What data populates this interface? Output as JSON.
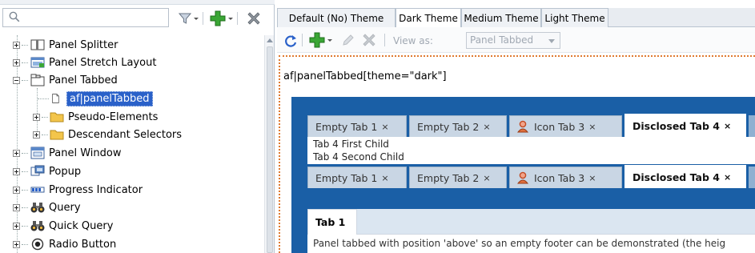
{
  "left_toolbar": {
    "search_placeholder": "",
    "icons": [
      "search-icon",
      "filter-icon",
      "chevron-down-icon",
      "add-icon",
      "chevron-down-icon",
      "delete-icon"
    ]
  },
  "tree": {
    "items": [
      {
        "label": "Panel Splitter",
        "icon": "panel-splitter-icon"
      },
      {
        "label": "Panel Stretch Layout",
        "icon": "panel-stretch-layout-icon"
      },
      {
        "label": "Panel Tabbed",
        "icon": "panel-tabbed-icon",
        "expanded": true
      },
      {
        "label": "af|panelTabbed",
        "icon": "document-icon",
        "selected": true
      },
      {
        "label": "Pseudo-Elements",
        "icon": "folder-icon"
      },
      {
        "label": "Descendant Selectors",
        "icon": "folder-icon"
      },
      {
        "label": "Panel Window",
        "icon": "panel-window-icon"
      },
      {
        "label": "Popup",
        "icon": "popup-icon"
      },
      {
        "label": "Progress Indicator",
        "icon": "progress-indicator-icon"
      },
      {
        "label": "Query",
        "icon": "binoculars-icon"
      },
      {
        "label": "Quick Query",
        "icon": "binoculars-icon"
      },
      {
        "label": "Radio Button",
        "icon": "radio-button-icon"
      }
    ]
  },
  "theme_tabs": [
    {
      "label": "Default (No) Theme"
    },
    {
      "label": "Dark Theme",
      "active": true
    },
    {
      "label": "Medium Theme"
    },
    {
      "label": "Light Theme"
    }
  ],
  "right_toolbar": {
    "view_as_label": "View as:",
    "view_as_value": "Panel Tabbed"
  },
  "preview": {
    "selector": "af|panelTabbed[theme=\"dark\"]",
    "tabs": [
      {
        "label": "Empty Tab 1",
        "close": "×"
      },
      {
        "label": "Empty Tab 2",
        "close": "×"
      },
      {
        "label": "Icon Tab 3",
        "close": "×",
        "icon": "user-icon"
      },
      {
        "label": "Disclosed Tab 4",
        "close": "×",
        "active": true
      }
    ],
    "content_lines": [
      "Tab 4 First Child",
      "Tab 4 Second Child"
    ],
    "lower_tab": "Tab 1",
    "lower_desc": "Panel tabbed with position 'above' so an empty footer can be demonstrated (the heig"
  },
  "colors": {
    "selection": "#2a61c9",
    "dark_panel": "#1a5fa6",
    "accent_green": "#3aa635",
    "focus_border": "#e07a30"
  }
}
